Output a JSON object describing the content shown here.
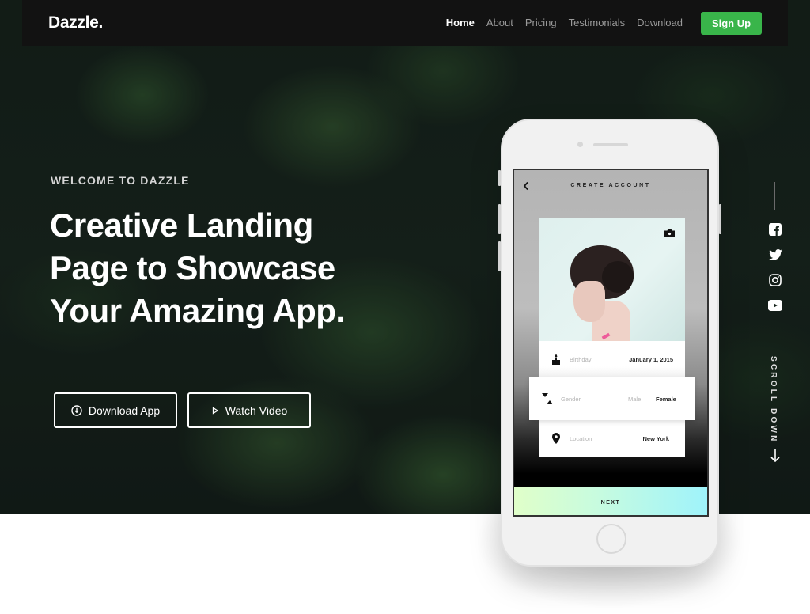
{
  "navbar": {
    "logo": "Dazzle.",
    "links": [
      {
        "label": "Home",
        "active": true
      },
      {
        "label": "About",
        "active": false
      },
      {
        "label": "Pricing",
        "active": false
      },
      {
        "label": "Testimonials",
        "active": false
      },
      {
        "label": "Download",
        "active": false
      }
    ],
    "signup_label": "Sign Up",
    "signup_color": "#39b54a"
  },
  "hero": {
    "eyebrow": "WELCOME TO DAZZLE",
    "headline_lines": [
      "Creative Landing",
      "Page to Showcase",
      "Your Amazing App."
    ],
    "buttons": [
      {
        "label": "Download App",
        "icon": "download-circle-icon"
      },
      {
        "label": "Watch Video",
        "icon": "play-icon"
      }
    ]
  },
  "social": {
    "icons": [
      "facebook-icon",
      "twitter-icon",
      "instagram-icon",
      "youtube-icon"
    ],
    "scroll_label": "SCROLL DOWN"
  },
  "phone_app": {
    "title": "CREATE ACCOUNT",
    "fields": {
      "birthday": {
        "label": "Birthday",
        "value": "January 1, 2015"
      },
      "gender": {
        "label": "Gender",
        "options": [
          "Male",
          "Female"
        ],
        "selected": "Female"
      },
      "location": {
        "label": "Location",
        "value": "New York"
      }
    },
    "next_label": "NEXT"
  }
}
